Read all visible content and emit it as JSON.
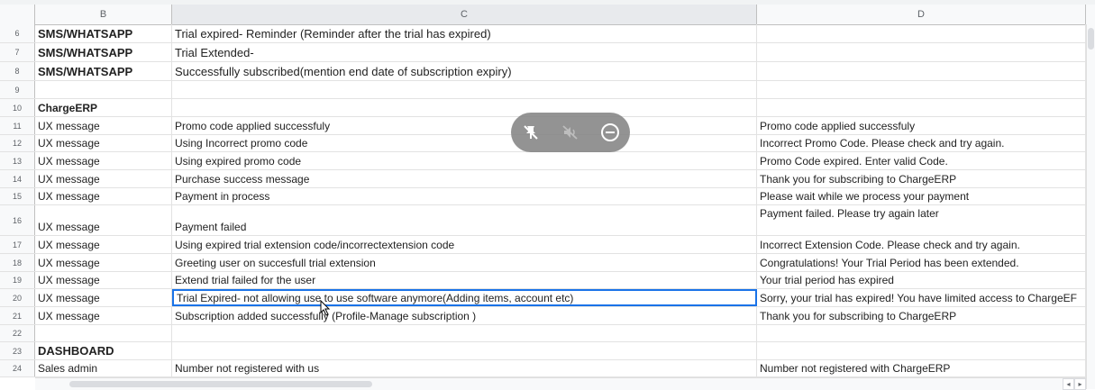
{
  "columns": {
    "b": "B",
    "c": "C",
    "d": "D"
  },
  "rows": [
    {
      "n": "6",
      "b": "SMS/WHATSAPP",
      "c": "Trial expired- Reminder (Reminder after the trial has expired)",
      "d": ""
    },
    {
      "n": "7",
      "b": "SMS/WHATSAPP",
      "c": "Trial Extended-",
      "d": ""
    },
    {
      "n": "8",
      "b": "SMS/WHATSAPP",
      "c": "Successfully subscribed(mention end date of subscription expiry)",
      "d": ""
    },
    {
      "n": "9",
      "b": "",
      "c": "",
      "d": ""
    },
    {
      "n": "10",
      "b": "ChargeERP",
      "c": "",
      "d": ""
    },
    {
      "n": "11",
      "b": "UX message",
      "c": "Promo code applied successfuly",
      "d": "Promo code applied successfuly"
    },
    {
      "n": "12",
      "b": "UX message",
      "c": "Using Incorrect promo code",
      "d": "Incorrect Promo Code. Please check and try again."
    },
    {
      "n": "13",
      "b": "UX message",
      "c": "Using expired promo code",
      "d": "Promo Code expired. Enter valid Code."
    },
    {
      "n": "14",
      "b": "UX message",
      "c": "Purchase success message",
      "d": "Thank you for subscribing to ChargeERP"
    },
    {
      "n": "15",
      "b": "UX message",
      "c": "Payment in process",
      "d": "Please wait while we process your payment"
    },
    {
      "n": "16",
      "b": "UX message",
      "c": "Payment failed",
      "d": "Payment failed. Please try again later"
    },
    {
      "n": "17",
      "b": "UX message",
      "c": "Using expired trial extension code/incorrectextension code",
      "d": "Incorrect Extension Code. Please check and try again."
    },
    {
      "n": "18",
      "b": "UX message",
      "c": "Greeting user on succesfull trial extension",
      "d": "Congratulations! Your Trial Period has been extended."
    },
    {
      "n": "19",
      "b": "UX message",
      "c": "Extend trial failed for the user",
      "d": "Your trial period has expired"
    },
    {
      "n": "20",
      "b": "UX message",
      "c": "Trial Expired- not allowing use to use software anymore(Adding items, account etc)",
      "d": "Sorry, your trial has expired! You have limited access to ChargeEF"
    },
    {
      "n": "21",
      "b": "UX message",
      "c": "Subscription added successfully (Profile-Manage subscription )",
      "d": "Thank you for subscribing to ChargeERP"
    },
    {
      "n": "22",
      "b": "",
      "c": "",
      "d": ""
    },
    {
      "n": "23",
      "b": "DASHBOARD",
      "c": "",
      "d": ""
    },
    {
      "n": "24",
      "b": "Sales admin",
      "c": "Number not registered with us",
      "d": "Number not registered with ChargeERP"
    }
  ]
}
